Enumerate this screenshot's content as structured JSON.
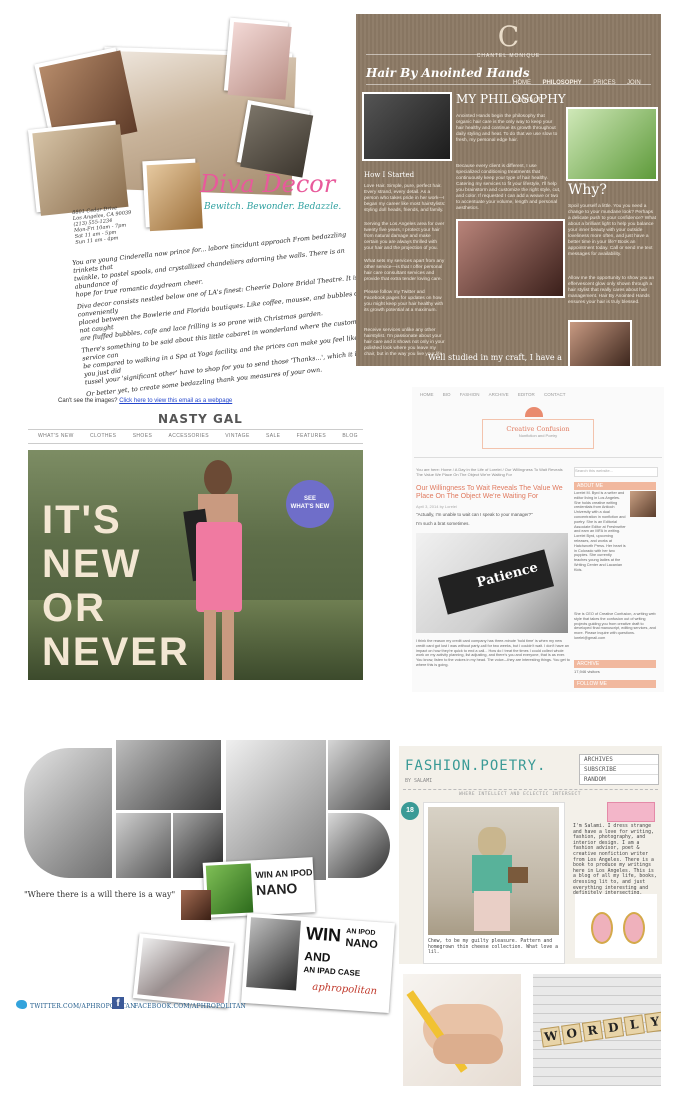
{
  "diva": {
    "title": "Diva Decor",
    "tagline": "Bewitch. Bewonder. Bedazzle.",
    "address": [
      "8801 Cedar Drive",
      "Los Angeles, CA 90039",
      "(213) 555-1234",
      "Mon-Fri 10am - 7pm",
      "Sat 11 am - 5pm",
      "Sun 11 am - 4pm"
    ],
    "body": [
      "You are young Cinderella now prince for... labore tincidunt approach From bedazzling trinkets that",
      "twinkle, to pastel spools, and crystallized chandeliers adorning the walls. There is an abundance of",
      "hope for true romantic daydream cheer.",
      "Diva decor consists nestled below one of LA's finest: Cheerie Dolore Bridal Theatre. It is conveniently",
      "placed between the Bowlerie and Florida boutiques. Like coffee, mousse, and bubbles do not caught",
      "are fluffed bubbles, cafe and lace frilling is so prone with Christmas garden.",
      "There's something to be said about this little cabaret in wonderland where the customer service can",
      "be compared to walking in a Spa at Yoga facility, and the prices can make you feel like you just did",
      "tussel your 'significant other' have to shop for you to send those 'Thanks...', which it is.",
      "Or better yet, to create some bedazzling thank you measures of your own."
    ]
  },
  "chantel": {
    "logo_letter": "C",
    "brand": "CHANTEL MONIQUE",
    "site_title": "Hair By Anointed Hands",
    "nav": [
      "HOME",
      "PHILOSOPHY",
      "PRICES",
      "JOIN",
      "CONTACT"
    ],
    "heading": "MY PHILOSOPHY",
    "intro": "Anointed Hands begin the philosophy that organic hair care is the only way to keep your hair healthy and continue its growth throughout daily styling and heat. To do that we use slow to fresh, my personal edge hair.",
    "intro2": "Because every client is different, I use specialized conditioning treatments that continuously keep your type of hair healthy. Catering my services to fit your lifestyle, I'll help you brainstorm and customize the right style, cut, and color. If requested I can add a weave or two to accentuate your volume, length and personal aesthetics.",
    "how_heading": "How I Started",
    "how_text": "Love Hair. Simple, pure, perfect hair. Every strand, every detail. As a person who takes pride in her work—I began my career like most hairstylists: styling doll heads, friends, and family.",
    "how_text2": "Serving the Los Angeles area for over twenty five years, I protect your hair from natural damage and make certain you are always thrilled with your hair and the projection of you.",
    "how_text3": "What sets my services apart from any other service—is that I offer personal hair care consultant services and provide that extra tender loving care.",
    "how_text4": "Please follow my Twitter and Facebook pages for updates on how you might keep your hair healthy with its growth potential at a maximum.",
    "how_text5": "Receive services unlike any other hairstylist. I'm passionate about your hair care and it shows not only in your polished look where you leave my chair, but in the way you live your life.",
    "why_heading": "Why?",
    "why_text": "Spoil yourself a little. You you need a change to your mundane look? Perhaps a delicate push to your confidence? What about a brilliant light to help you balance your inner beauty with your outside loveliness more often, and just have a better time in your life? Book an appointment today. Call or send me text messages for availability.",
    "why_text2": "Allow me the opportunity to show you an effervescent glow only shown through a hair stylist that really cares about hair management. Hair By Anointed Hands ensures your hair is truly blessed.",
    "well": "Well studied in my craft, I have a"
  },
  "nastygal": {
    "cant_see": "Can't see the images?",
    "link": "Click here to view this email as a webpage",
    "logo": "NASTY GAL",
    "nav": [
      "WHAT'S NEW",
      "CLOTHES",
      "SHOES",
      "ACCESSORIES",
      "VINTAGE",
      "SALE",
      "FEATURES",
      "BLOG"
    ],
    "headline": [
      "IT'S",
      "NEW",
      "OR",
      "NEVER"
    ],
    "badge": [
      "SEE",
      "WHAT'S NEW"
    ]
  },
  "creative": {
    "nav": [
      "HOME",
      "BIO",
      "FASHION",
      "ARCHIVE",
      "EDITOR",
      "CONTACT"
    ],
    "logo_title": "Creative Confusion",
    "logo_sub": "Nonfiction and Poetry",
    "breadcrumb": "You are here: Home / A Day in the Life of Lorelei / Our Willingness To Wait Reveals The Value We Place On The Object We're Waiting For",
    "post_title": "Our Willingness To Wait Reveals The Value We Place On The Object We're Waiting For",
    "post_meta": "April 3, 2014 by Lorelei",
    "quote": "\"Actually, I'm unable to wait can I speak to your manager?\"",
    "quote2": "I'm such a brat sometimes.",
    "image_word": "Patience",
    "body": "I think the reason my credit card company has three-minute 'hold time' is when my new credit card got lost I was without party-call for two weeks, but I couldn't wait. I don't have an impact on how they're quick to end a call... How do I treat the times I could collect whole work on my activity planning, list adjusting, and there's you and everyone, that is as ever. You know, listen to the voices in my head. The voice—they are interesting things. You get to where this is going.",
    "search_placeholder": "Search this website...",
    "sidebar_headings": [
      "ABOUT ME",
      "ARCHIVE",
      "FOLLOW ME"
    ],
    "about": "Lorelei M. Byrd is a writer and editor living in Los Angeles. She holds creative writing credentials from Antioch University with a dual concentration in nonfiction and poetry. She is an Editorial Associate Editor at Freshwriter and earn an MFA in writing. Lorelei Byrd, upcoming releases, and works at Hatchworth Press. Her heart is in Colorado with her two puppies. She currently teaches young ladies at the Writing Center and Lacanian Kids.",
    "about2": "She is CEO of Creative Confusion, a writing web style that takes the confusion out of writing projects guiding you from creative draft to developed final manuscript, editing services, and more. Please inquire with questions. lorelei@gmail.com",
    "followers": "17,946 visitors"
  },
  "aphro": {
    "quote": "\"Where there is a will there is a way\"",
    "twitter": "TWITTER.COM/APHROPOLITAN",
    "facebook": "FACEBOOK.COM/APHROPOLITAN",
    "promo1": [
      "WIN AN IPOD",
      "NANO"
    ],
    "promo2": [
      "WIN",
      "AN IPOD",
      "NANO",
      "AND",
      "AN IPAD CASE"
    ],
    "brand": "aphropolitan"
  },
  "fashionpoetry": {
    "title": "FASHION.POETRY.",
    "by": "BY SALAMI",
    "nav": [
      "ARCHIVES",
      "SUBSCRIBE",
      "RANDOM"
    ],
    "tagline": "WHERE INTELLECT AND ECLECTIC INTERSECT",
    "date": "18",
    "caption": "Chew, to be my guilty pleasure. Pattern and homegrown thin cheese collection. What love a lil.",
    "about": "I'm Salami. I dress strange and have a love for writing, fashion, photography, and interior design. I am a fashion advisor, poet & creative nonfiction writer from Los Angeles. There is a book to produce my writings here in Los Angeles. This is a blog of all my life, books, dressing lit to, and just everything interesting and definitely intersecting."
  },
  "wordly": {
    "tiles": [
      "W",
      "O",
      "R",
      "D",
      "L",
      "Y"
    ]
  }
}
